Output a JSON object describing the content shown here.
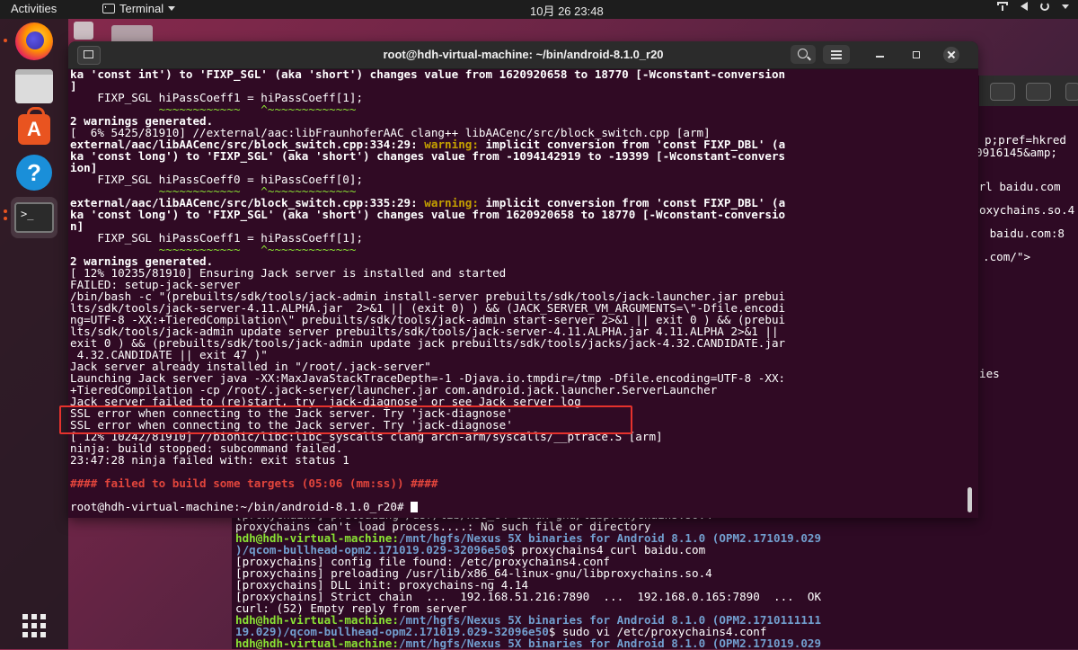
{
  "topbar": {
    "activities": "Activities",
    "app_name": "Terminal",
    "clock": "10月 26  23:48"
  },
  "dock": {
    "apps": [
      "firefox",
      "files",
      "software-center",
      "help",
      "terminal",
      "show-applications"
    ]
  },
  "window": {
    "title": "root@hdh-virtual-machine: ~/bin/android-8.1.0_r20"
  },
  "terminal": {
    "lines": [
      {
        "t": "ka 'const int') to 'FIXP_SGL' (aka 'short') changes value from 1620920658 to 18770 [-Wconstant-conversion",
        "c": "w"
      },
      {
        "t": "]",
        "c": "w"
      },
      {
        "t": "    FIXP_SGL hiPassCoeff1 = hiPassCoeff[1];",
        "c": "n"
      },
      {
        "t": "             ~~~~~~~~~~~~   ^~~~~~~~~~~~~~",
        "c": "tilde"
      },
      {
        "t": "2 warnings generated.",
        "c": "w"
      },
      {
        "t": "[  6% 5425/81910] //external/aac:libFraunhoferAAC clang++ libAACenc/src/block_switch.cpp [arm]",
        "c": "n"
      },
      {
        "t": "external/aac/libAACenc/src/block_switch.cpp:334:29: ",
        "c": "w",
        "warn": "warning:",
        "rest": " implicit conversion from 'const FIXP_DBL' (a"
      },
      {
        "t": "ka 'const long') to 'FIXP_SGL' (aka 'short') changes value from -1094142919 to -19399 [-Wconstant-convers",
        "c": "w"
      },
      {
        "t": "ion]",
        "c": "w"
      },
      {
        "t": "    FIXP_SGL hiPassCoeff0 = hiPassCoeff[0];",
        "c": "n"
      },
      {
        "t": "             ~~~~~~~~~~~~   ^~~~~~~~~~~~~~",
        "c": "tilde"
      },
      {
        "t": "external/aac/libAACenc/src/block_switch.cpp:335:29: ",
        "c": "w",
        "warn": "warning:",
        "rest": " implicit conversion from 'const FIXP_DBL' (a"
      },
      {
        "t": "ka 'const long') to 'FIXP_SGL' (aka 'short') changes value from 1620920658 to 18770 [-Wconstant-conversio",
        "c": "w"
      },
      {
        "t": "n]",
        "c": "w"
      },
      {
        "t": "    FIXP_SGL hiPassCoeff1 = hiPassCoeff[1];",
        "c": "n"
      },
      {
        "t": "             ~~~~~~~~~~~~   ^~~~~~~~~~~~~~",
        "c": "tilde"
      },
      {
        "t": "2 warnings generated.",
        "c": "w"
      },
      {
        "t": "[ 12% 10235/81910] Ensuring Jack server is installed and started",
        "c": "n"
      },
      {
        "t": "FAILED: setup-jack-server",
        "c": "n"
      },
      {
        "t": "/bin/bash -c \"(prebuilts/sdk/tools/jack-admin install-server prebuilts/sdk/tools/jack-launcher.jar prebui",
        "c": "n"
      },
      {
        "t": "lts/sdk/tools/jack-server-4.11.ALPHA.jar  2>&1 || (exit 0) ) && (JACK_SERVER_VM_ARGUMENTS=\\\"-Dfile.encodi",
        "c": "n"
      },
      {
        "t": "ng=UTF-8 -XX:+TieredCompilation\\\" prebuilts/sdk/tools/jack-admin start-server 2>&1 || exit 0 ) && (prebui",
        "c": "n"
      },
      {
        "t": "lts/sdk/tools/jack-admin update server prebuilts/sdk/tools/jack-server-4.11.ALPHA.jar 4.11.ALPHA 2>&1 ||",
        "c": "n"
      },
      {
        "t": "exit 0 ) && (prebuilts/sdk/tools/jack-admin update jack prebuilts/sdk/tools/jacks/jack-4.32.CANDIDATE.jar",
        "c": "n"
      },
      {
        "t": " 4.32.CANDIDATE || exit 47 )\"",
        "c": "n"
      },
      {
        "t": "Jack server already installed in \"/root/.jack-server\"",
        "c": "n"
      },
      {
        "t": "Launching Jack server java -XX:MaxJavaStackTraceDepth=-1 -Djava.io.tmpdir=/tmp -Dfile.encoding=UTF-8 -XX:",
        "c": "n"
      },
      {
        "t": "+TieredCompilation -cp /root/.jack-server/launcher.jar com.android.jack.launcher.ServerLauncher",
        "c": "n"
      },
      {
        "t": "Jack server failed to (re)start, try 'jack-diagnose' or see Jack server log",
        "c": "n"
      },
      {
        "t": "SSL error when connecting to the Jack server. Try 'jack-diagnose'",
        "c": "n"
      },
      {
        "t": "SSL error when connecting to the Jack server. Try 'jack-diagnose'",
        "c": "n"
      },
      {
        "t": "[ 12% 10242/81910] //bionic/libc:libc_syscalls clang arch-arm/syscalls/__ptrace.S [arm]",
        "c": "n"
      },
      {
        "t": "ninja: build stopped: subcommand failed.",
        "c": "n"
      },
      {
        "t": "23:47:28 ninja failed with: exit status 1",
        "c": "n"
      },
      {
        "t": "",
        "c": "n"
      },
      {
        "t": "#### failed to build some targets (05:06 (mm:ss)) ####",
        "c": "err"
      },
      {
        "t": "",
        "c": "n"
      }
    ],
    "prompt": "root@hdh-virtual-machine:~/bin/android-8.1.0_r20# "
  },
  "background_terminal": {
    "right_fragments": [
      "p;pref=hkred",
      "0916145&amp;",
      "url baidu.com",
      "oxychains.so.4",
      " baidu.com:8",
      ".com/\">",
      "ies"
    ],
    "lines": [
      {
        "p": "",
        "t": "[proxychains] preloading /usr/lib/x86_64-linux-gnu/libproxychains.so.4"
      },
      {
        "p": "",
        "t": "proxychains can't load process....: No such file or directory"
      },
      {
        "p": "hdh@hdh-virtual-machine",
        "d": "/mnt/hgfs/Nexus 5X binaries for Android 8.1.0 (OPM2.171019.029",
        "t": ""
      },
      {
        "p": "",
        "d": ")/qcom-bullhead-opm2.171019.029-32096e50",
        "t": "$ proxychains4 curl baidu.com"
      },
      {
        "p": "",
        "t": "[proxychains] config file found: /etc/proxychains4.conf"
      },
      {
        "p": "",
        "t": "[proxychains] preloading /usr/lib/x86_64-linux-gnu/libproxychains.so.4"
      },
      {
        "p": "",
        "t": "[proxychains] DLL init: proxychains-ng 4.14"
      },
      {
        "p": "",
        "t": "[proxychains] Strict chain  ...  192.168.51.216:7890  ...  192.168.0.165:7890  ...  OK"
      },
      {
        "p": "",
        "t": "curl: (52) Empty reply from server"
      },
      {
        "p": "hdh@hdh-virtual-machine",
        "d": "/mnt/hgfs/Nexus 5X binaries for Android 8.1.0 (OPM2.1710111111",
        "t": ""
      },
      {
        "p": "",
        "d": "19.029)/qcom-bullhead-opm2.171019.029-32096e50",
        "t": "$ sudo vi /etc/proxychains4.conf"
      },
      {
        "p": "hdh@hdh-virtual-machine",
        "d": "/mnt/hgfs/Nexus 5X binaries for Android 8.1.0 (OPM2.171019.029",
        "t": ""
      }
    ]
  }
}
